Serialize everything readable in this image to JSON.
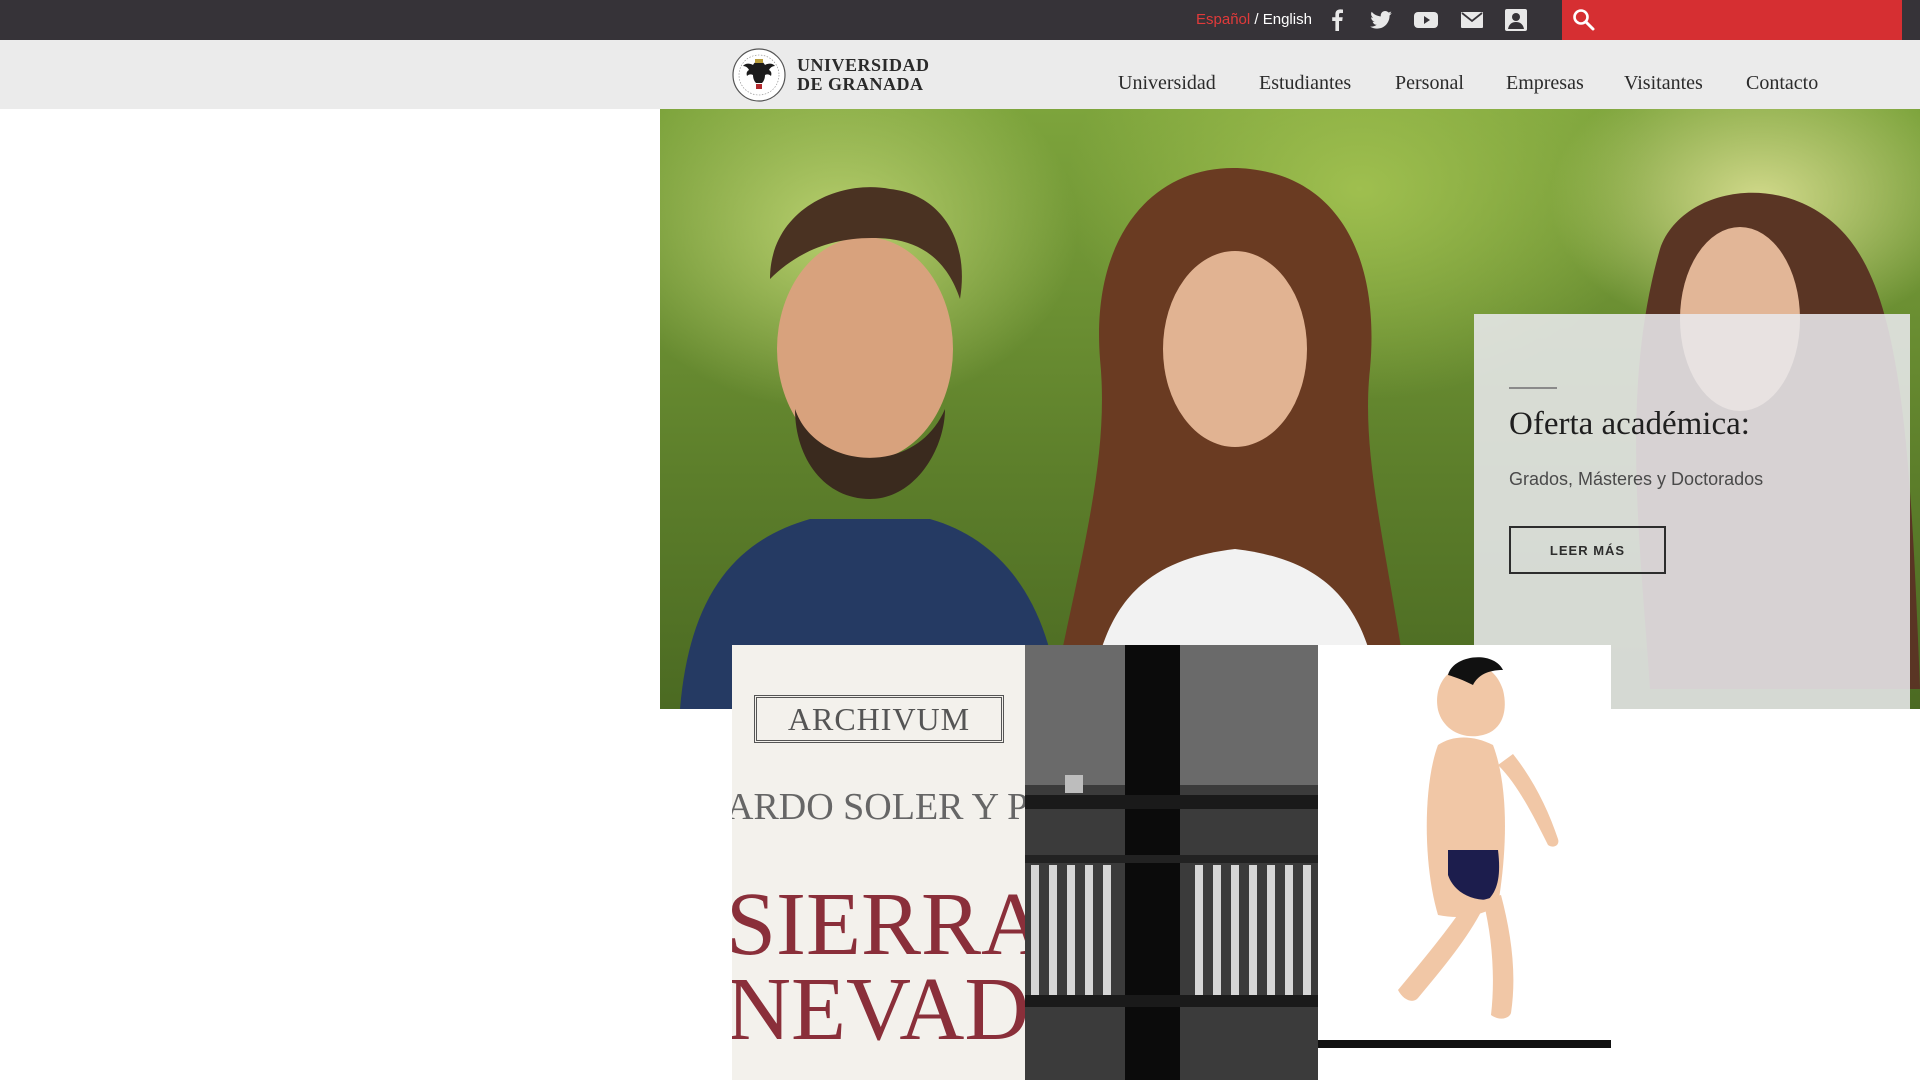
{
  "topbar": {
    "lang_es": "Español",
    "lang_sep": " / ",
    "lang_en": "English",
    "social_icons": [
      "facebook-icon",
      "twitter-icon",
      "youtube-icon",
      "mail-icon",
      "directory-icon"
    ],
    "search_placeholder": "",
    "colors": {
      "bar": "#363338",
      "search": "#d62f32",
      "active_lang": "#e03a3a"
    }
  },
  "header": {
    "logo_line1": "UNIVERSIDAD",
    "logo_line2": "DE GRANADA",
    "nav": [
      "Universidad",
      "Estudiantes",
      "Personal",
      "Empresas",
      "Visitantes",
      "Contacto"
    ]
  },
  "hero": {
    "card_title": "Oferta académica:",
    "card_subtitle": "Grados, Másteres y Doctorados",
    "card_button": "LEER MÁS"
  },
  "tiles": {
    "tile1": {
      "sign": "ARCHIVUM",
      "line1": "ARDO SOLER Y P",
      "line2": "SIERRA",
      "line3": "NEVADA"
    }
  }
}
